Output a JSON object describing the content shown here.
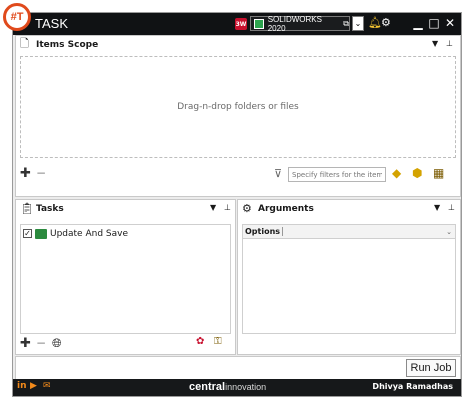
{
  "app": {
    "title": "TASK",
    "logo_text": "#T"
  },
  "titlebar": {
    "version_label": "SOLIDWORKS 2020",
    "sw_badge": "3W",
    "icons": [
      "solidworks-icon",
      "bell-icon",
      "gear-icon",
      "minimize-icon",
      "maximize-icon",
      "close-icon"
    ]
  },
  "items_scope": {
    "title": "Items Scope",
    "drop_text": "Drag-n-drop folders or files",
    "filter_placeholder": "Specify filters for the items"
  },
  "tasks": {
    "title": "Tasks",
    "items": [
      {
        "label": "Update And Save",
        "checked": true
      }
    ]
  },
  "arguments": {
    "title": "Arguments",
    "options_label": "Options"
  },
  "run": {
    "label": "Run Job"
  },
  "footer": {
    "brand_main": "central",
    "brand_sub": "innovation",
    "user": "Dhivya Ramadhas",
    "social": [
      "linkedin-icon",
      "youtube-icon",
      "mail-icon"
    ]
  },
  "colors": {
    "accent": "#e04a1c",
    "titlebar": "#101214",
    "footer": "#16181a",
    "panel_bg": "#ececec"
  }
}
